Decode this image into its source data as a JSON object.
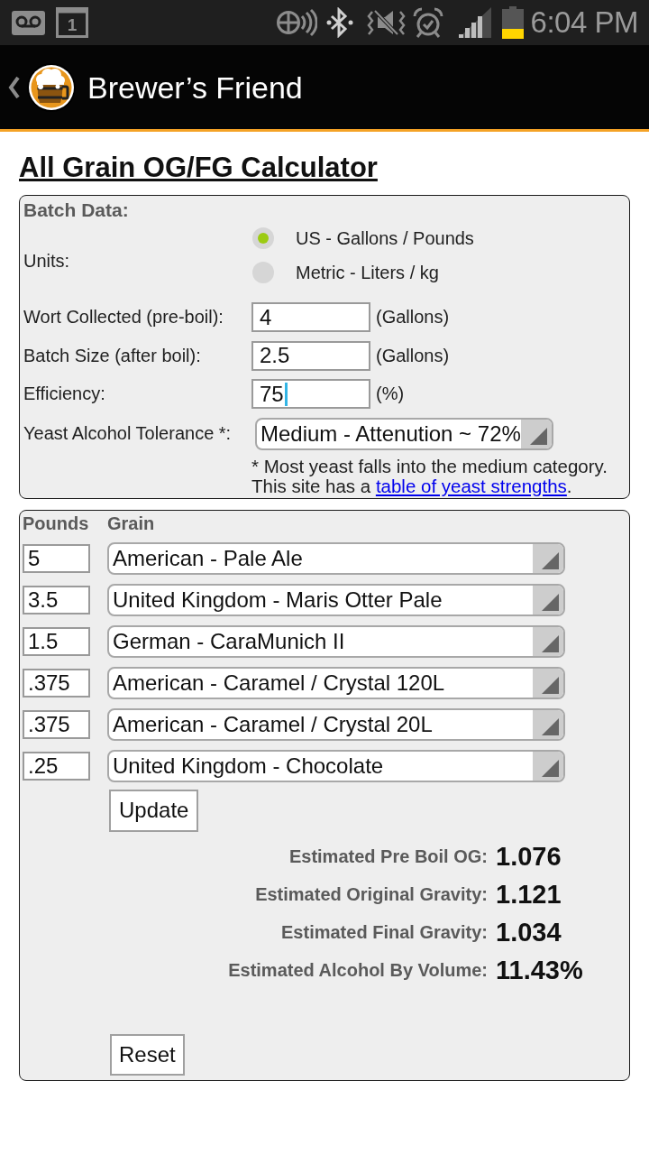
{
  "status_bar": {
    "calendar_day": "1",
    "time": "6:04 PM"
  },
  "app_bar": {
    "title": "Brewer’s Friend"
  },
  "heading": "All Grain OG/FG Calculator",
  "batch_data": {
    "title": "Batch Data:",
    "units_label": "Units:",
    "units": [
      {
        "label": "US - Gallons / Pounds",
        "selected": true
      },
      {
        "label": "Metric - Liters / kg",
        "selected": false
      }
    ],
    "fields": [
      {
        "label": "Wort Collected (pre-boil):",
        "value": "4",
        "unit": "(Gallons)",
        "focused": false
      },
      {
        "label": "Batch Size (after boil):",
        "value": "2.5",
        "unit": "(Gallons)",
        "focused": false
      },
      {
        "label": "Efficiency:",
        "value": "75",
        "unit": "(%)",
        "focused": true
      }
    ],
    "yeast_tolerance": {
      "label": "Yeast Alcohol Tolerance *:",
      "value": "Medium - Attenution ~ 72%"
    },
    "note": {
      "line_1": "* Most yeast falls into the medium category.",
      "line_2_before_link": "This site has a ",
      "link": "table of yeast strengths",
      "line_2_after_link": "."
    }
  },
  "grain_bill": {
    "columns": [
      "Pounds",
      "Grain"
    ],
    "rows": [
      {
        "pounds": "5",
        "grain": "American - Pale Ale"
      },
      {
        "pounds": "3.5",
        "grain": "United Kingdom - Maris Otter Pale"
      },
      {
        "pounds": "1.5",
        "grain": "German - CaraMunich II"
      },
      {
        "pounds": ".375",
        "grain": "American - Caramel / Crystal 120L"
      },
      {
        "pounds": ".375",
        "grain": "American - Caramel / Crystal 20L"
      },
      {
        "pounds": ".25",
        "grain": "United Kingdom - Chocolate"
      }
    ],
    "update_button": "Update",
    "results": [
      {
        "label": "Estimated Pre Boil OG:",
        "value": "1.076"
      },
      {
        "label": "Estimated Original Gravity:",
        "value": "1.121"
      },
      {
        "label": "Estimated Final Gravity:",
        "value": "1.034"
      },
      {
        "label": "Estimated Alcohol By Volume:",
        "value": "11.43%"
      }
    ],
    "reset_button": "Reset"
  }
}
